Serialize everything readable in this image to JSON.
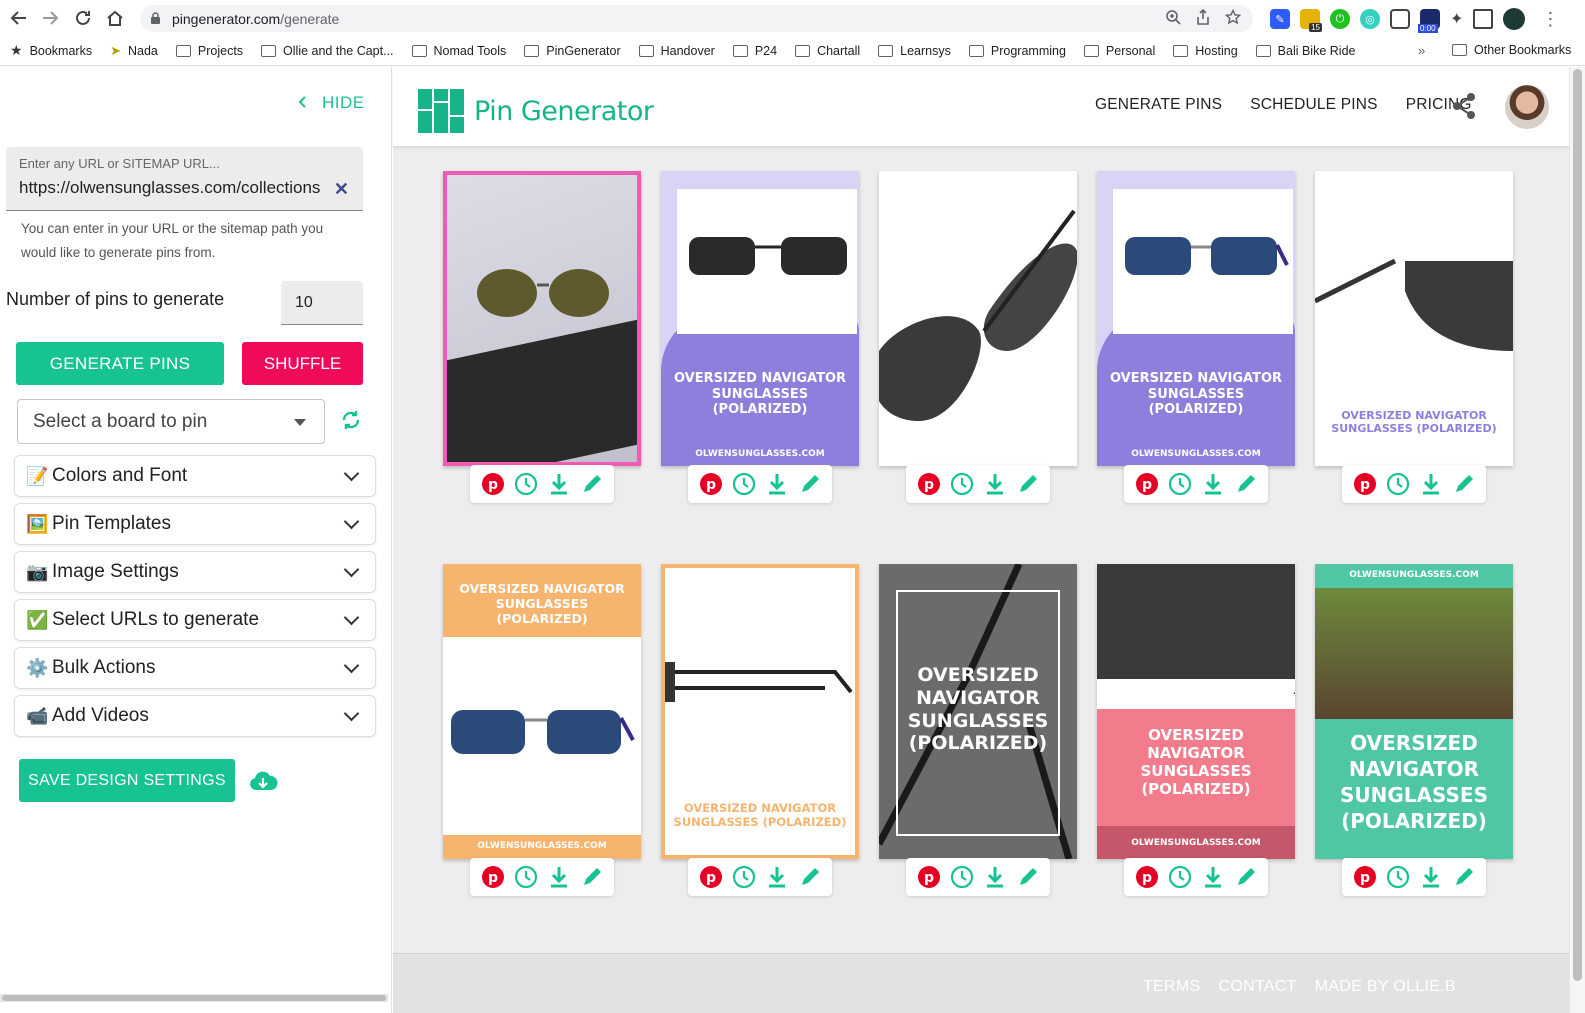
{
  "browser": {
    "url_host": "pingenerator.com",
    "url_path": "/generate",
    "bookmarks": [
      "Bookmarks",
      "Nada",
      "Projects",
      "Ollie and the Capt...",
      "Nomad Tools",
      "PinGenerator",
      "Handover",
      "P24",
      "Chartall",
      "Learnsys",
      "Programming",
      "Personal",
      "Hosting",
      "Bali Bike Ride"
    ],
    "more": "»",
    "other_bookmarks": "Other Bookmarks",
    "ext_badge_count": "15",
    "ext_timer": "0:00"
  },
  "sidebar": {
    "hide_label": "HIDE",
    "url_placeholder": "Enter any URL or SITEMAP URL...",
    "url_value": "https://olwensunglasses.com/collections",
    "url_hint": "You can enter in your URL or the sitemap path you would like to generate pins from.",
    "num_label": "Number of pins to generate",
    "num_value": "10",
    "generate_label": "GENERATE PINS",
    "shuffle_label": "SHUFFLE",
    "board_placeholder": "Select a board to pin",
    "accordions": [
      {
        "emoji": "📝",
        "label": "Colors and Font"
      },
      {
        "emoji": "🖼️",
        "label": "Pin Templates"
      },
      {
        "emoji": "📷",
        "label": "Image Settings"
      },
      {
        "emoji": "✅",
        "label": "Select URLs to generate"
      },
      {
        "emoji": "⚙️",
        "label": "Bulk Actions"
      },
      {
        "emoji": "📹",
        "label": "Add Videos"
      }
    ],
    "save_label": "SAVE DESIGN SETTINGS"
  },
  "header": {
    "logo_text": "Pin Generator",
    "nav": [
      "GENERATE PINS",
      "SCHEDULE PINS",
      "PRICING"
    ]
  },
  "pins": {
    "title": "OVERSIZED NAVIGATOR SUNGLASSES (POLARIZED)",
    "domain": "OLWENSUNGLASSES.COM"
  },
  "footer": {
    "links": [
      "TERMS",
      "CONTACT",
      "MADE BY OLLIE.B"
    ]
  },
  "colors": {
    "brand_green": "#17c293",
    "shuffle_pink": "#ef0a5a",
    "pin_purple": "#8e7fdd",
    "pin_orange": "#f6b46e",
    "pin_pink": "#f27b8c",
    "pin_teal": "#4fc6a4",
    "selected_border": "#f15bb5"
  }
}
